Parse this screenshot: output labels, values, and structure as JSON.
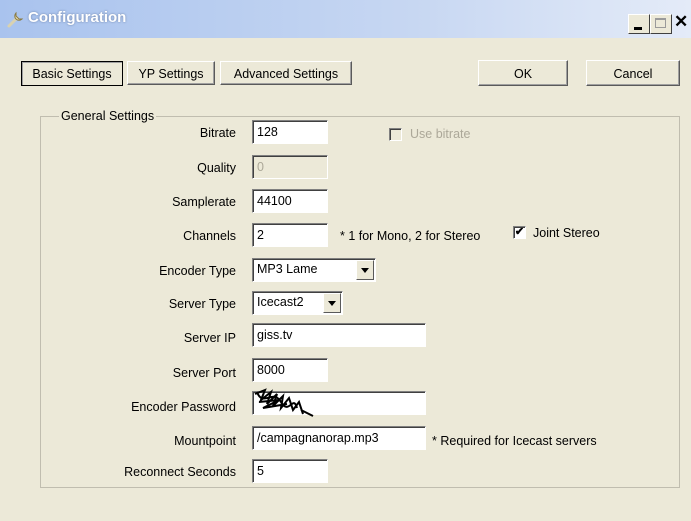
{
  "window": {
    "title": "Configuration"
  },
  "tabs": {
    "basic": "Basic Settings",
    "yp": "YP Settings",
    "advanced": "Advanced Settings"
  },
  "buttons": {
    "ok": "OK",
    "cancel": "Cancel"
  },
  "group": {
    "title": "General Settings"
  },
  "form": {
    "bitrate": {
      "label": "Bitrate",
      "value": "128"
    },
    "use_bitrate": {
      "label": "Use bitrate",
      "checked": false,
      "enabled": false
    },
    "quality": {
      "label": "Quality",
      "value": "0",
      "enabled": false
    },
    "samplerate": {
      "label": "Samplerate",
      "value": "44100"
    },
    "channels": {
      "label": "Channels",
      "value": "2",
      "hint": "* 1 for Mono, 2 for Stereo"
    },
    "joint_stereo": {
      "label": "Joint Stereo",
      "checked": true
    },
    "encoder_type": {
      "label": "Encoder Type",
      "value": "MP3 Lame"
    },
    "server_type": {
      "label": "Server Type",
      "value": "Icecast2"
    },
    "server_ip": {
      "label": "Server IP",
      "value": "giss.tv"
    },
    "server_port": {
      "label": "Server Port",
      "value": "8000"
    },
    "encoder_password": {
      "label": "Encoder Password",
      "value": ""
    },
    "mountpoint": {
      "label": "Mountpoint",
      "value": "/campagnanorap.mp3",
      "hint": "* Required for Icecast servers"
    },
    "reconnect_seconds": {
      "label": "Reconnect Seconds",
      "value": "5"
    }
  },
  "icons": {
    "app": "wrench-icon",
    "minimize": "minimize-icon",
    "maximize": "maximize-icon",
    "close": "close-icon",
    "dropdown": "chevron-down-icon",
    "checkmark": "checkmark-icon"
  }
}
